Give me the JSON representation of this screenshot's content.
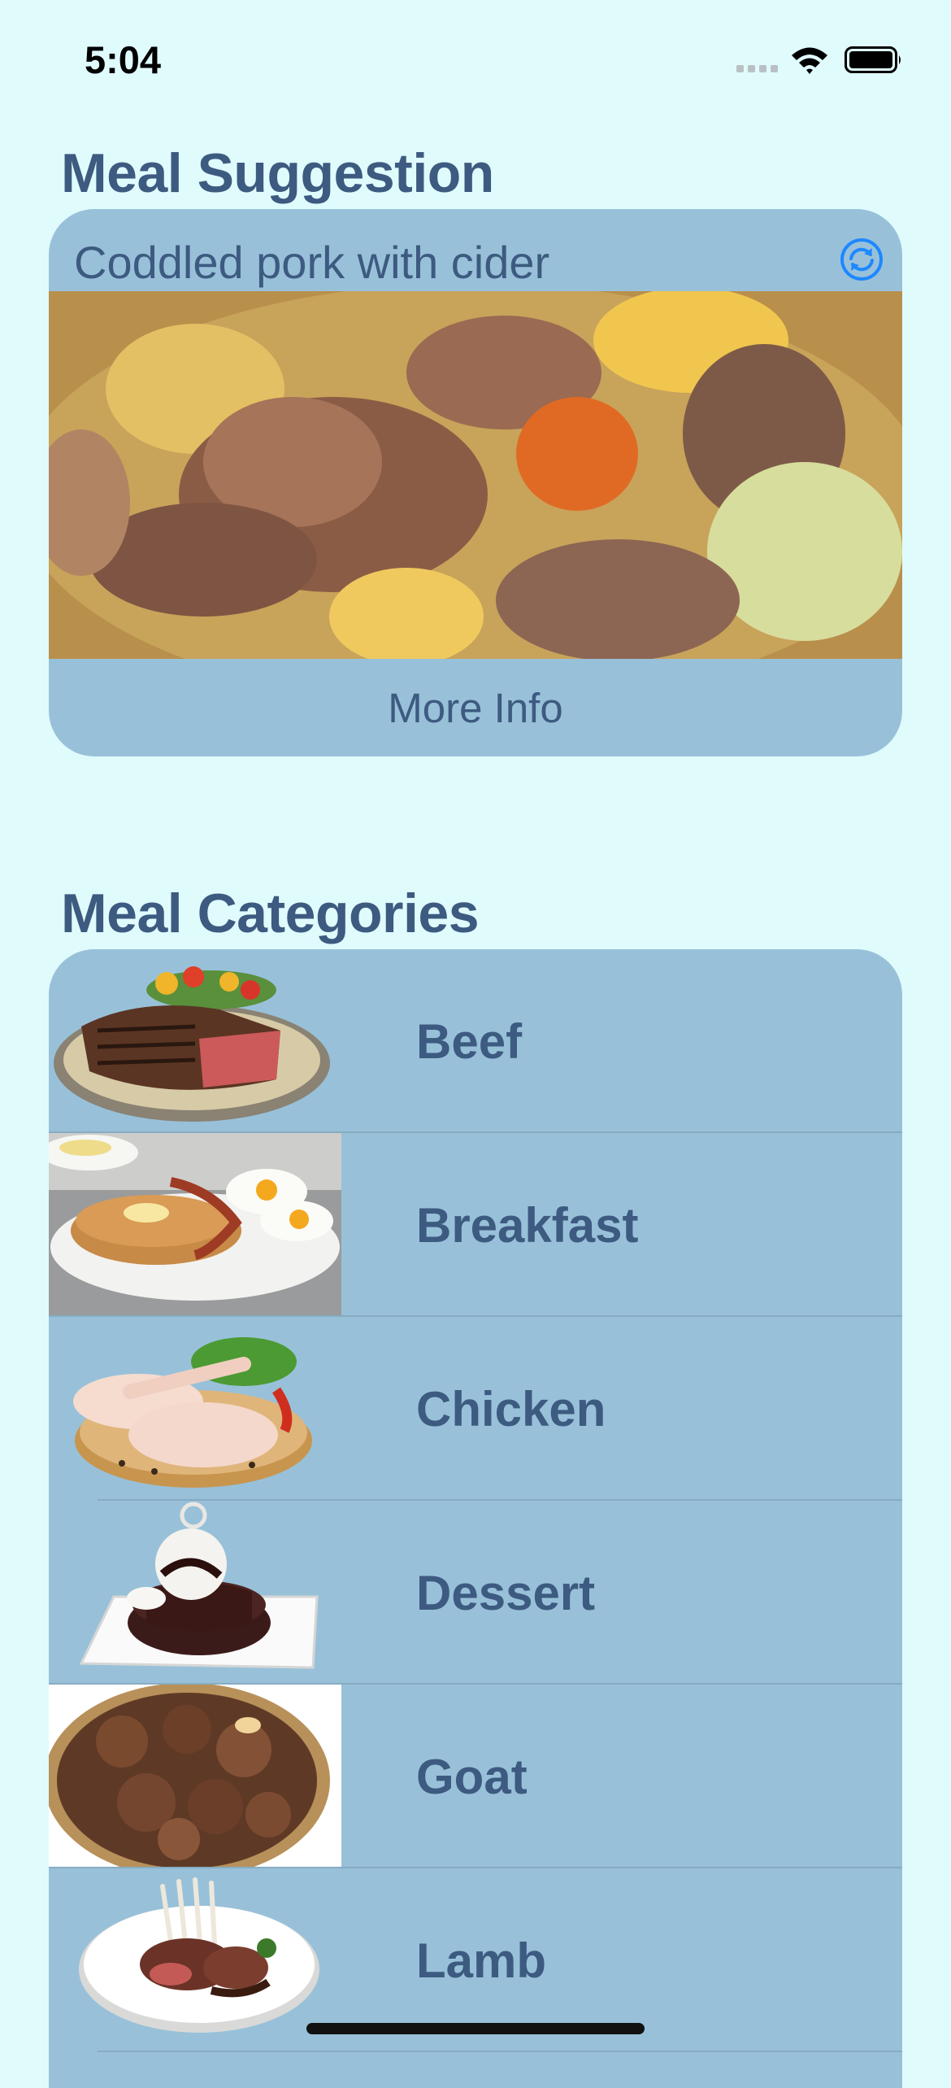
{
  "status_bar": {
    "time": "5:04"
  },
  "suggestion": {
    "section_title": "Meal Suggestion",
    "meal_name": "Coddled pork with cider",
    "refresh_icon": "arrow-circle-refresh-icon",
    "more_info_label": "More Info"
  },
  "categories": {
    "section_title": "Meal Categories",
    "items": [
      {
        "label": "Beef"
      },
      {
        "label": "Breakfast"
      },
      {
        "label": "Chicken"
      },
      {
        "label": "Dessert"
      },
      {
        "label": "Goat"
      },
      {
        "label": "Lamb"
      }
    ]
  },
  "colors": {
    "background": "#e0fbfc",
    "card": "#98c1d9",
    "text": "#3d5a80",
    "accent": "#1e88ff"
  }
}
